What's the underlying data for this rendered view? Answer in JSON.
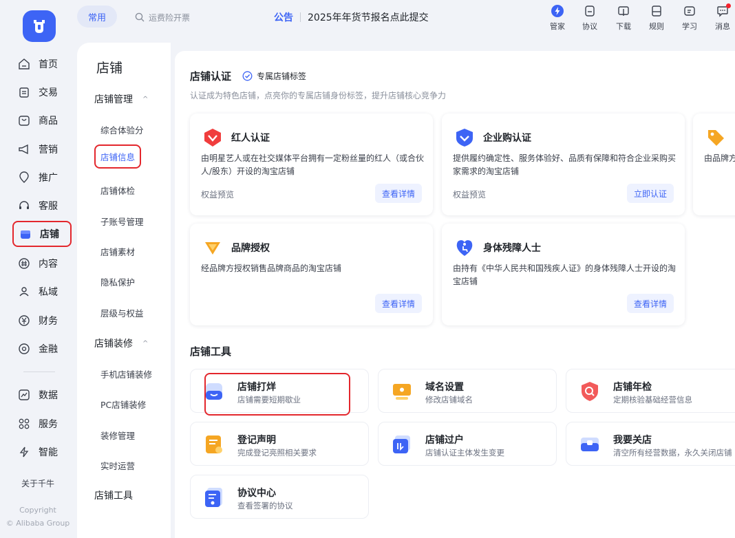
{
  "header": {
    "favorites_label": "常用",
    "search_placeholder": "运费险开票",
    "notice_tag": "公告",
    "notice_text": "2025年年货节报名点此提交",
    "tools": [
      {
        "label": "管家",
        "icon": "lightning-icon"
      },
      {
        "label": "协议",
        "icon": "agreement-icon"
      },
      {
        "label": "下载",
        "icon": "download-icon"
      },
      {
        "label": "规则",
        "icon": "rules-icon"
      },
      {
        "label": "学习",
        "icon": "learn-icon"
      },
      {
        "label": "消息",
        "icon": "message-icon"
      }
    ]
  },
  "nav": {
    "items": [
      {
        "label": "首页",
        "icon": "home-icon"
      },
      {
        "label": "交易",
        "icon": "trade-icon"
      },
      {
        "label": "商品",
        "icon": "goods-icon"
      },
      {
        "label": "营销",
        "icon": "marketing-icon"
      },
      {
        "label": "推广",
        "icon": "promotion-icon"
      },
      {
        "label": "客服",
        "icon": "service-icon"
      },
      {
        "label": "店铺",
        "icon": "shop-icon",
        "active": true
      },
      {
        "label": "内容",
        "icon": "content-icon"
      },
      {
        "label": "私域",
        "icon": "private-domain-icon"
      },
      {
        "label": "财务",
        "icon": "finance-icon"
      },
      {
        "label": "金融",
        "icon": "loan-icon"
      },
      {
        "label": "数据",
        "icon": "data-icon"
      },
      {
        "label": "服务",
        "icon": "apps-icon"
      },
      {
        "label": "智能",
        "icon": "ai-icon"
      }
    ],
    "about": "关于千牛",
    "copyright_1": "Copyright",
    "copyright_2": "© Alibaba Group"
  },
  "submenu": {
    "title": "店铺",
    "group1": "店铺管理",
    "group1_items": [
      "综合体验分",
      "店铺信息",
      "店铺体检",
      "子账号管理",
      "店铺素材",
      "隐私保护",
      "层级与权益"
    ],
    "group2": "店铺装修",
    "group2_items": [
      "手机店铺装修",
      "PC店铺装修",
      "装修管理",
      "实时运营"
    ],
    "group3": "店铺工具",
    "active_item": "店铺信息"
  },
  "certification": {
    "title": "店铺认证",
    "badge": "专属店铺标签",
    "desc": "认证成为特色店铺，点亮你的专属店铺身份标签，提升店铺核心竞争力",
    "cards": [
      {
        "title": "红人认证",
        "desc": "由明星艺人或在社交媒体平台拥有一定粉丝量的红人（或合伙人/股东）开设的淘宝店铺",
        "foot": "权益预览",
        "button": "查看详情",
        "icon": "influencer-icon"
      },
      {
        "title": "企业购认证",
        "desc": "提供履约确定性、服务体验好、品质有保障和符合企业采购买家需求的淘宝店铺",
        "foot": "权益预览",
        "button": "立即认证",
        "icon": "enterprise-icon"
      },
      {
        "title": "",
        "desc": "由品牌方",
        "foot": "",
        "button": "",
        "icon": "tag-icon"
      },
      {
        "title": "品牌授权",
        "desc": "经品牌方授权销售品牌商品的淘宝店铺",
        "foot": "",
        "button": "查看详情",
        "icon": "brand-icon"
      },
      {
        "title": "身体残障人士",
        "desc": "由持有《中华人民共和国残疾人证》的身体残障人士开设的淘宝店铺",
        "foot": "",
        "button": "查看详情",
        "icon": "accessibility-icon"
      }
    ]
  },
  "tools": {
    "title": "店铺工具",
    "items": [
      {
        "name": "店铺打烊",
        "desc": "店铺需要短期歇业",
        "icon": "close-shop-icon"
      },
      {
        "name": "域名设置",
        "desc": "修改店铺域名",
        "icon": "domain-icon"
      },
      {
        "name": "店铺年检",
        "desc": "定期核验基础经营信息",
        "icon": "annual-check-icon"
      },
      {
        "name": "登记声明",
        "desc": "完成登记亮照相关要求",
        "icon": "register-icon"
      },
      {
        "name": "店铺过户",
        "desc": "店铺认证主体发生变更",
        "icon": "transfer-icon"
      },
      {
        "name": "我要关店",
        "desc": "清空所有经营数据，永久关闭店铺",
        "icon": "shutdown-icon"
      },
      {
        "name": "协议中心",
        "desc": "查看签署的协议",
        "icon": "agreement-center-icon"
      }
    ]
  },
  "colors": {
    "accent": "#3d64f5",
    "highlight": "#e3262c",
    "background": "#f1f3f8"
  }
}
